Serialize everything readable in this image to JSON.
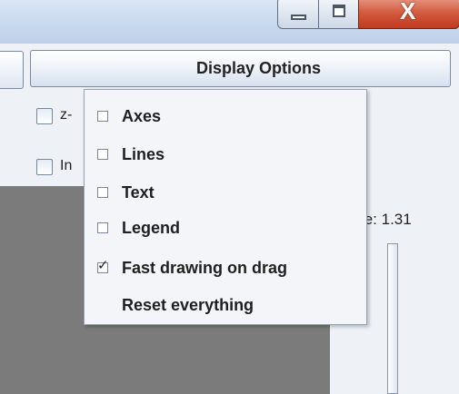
{
  "window_controls": {
    "minimize_icon": "minimize-icon",
    "maximize_icon": "maximize-icon",
    "close_icon": "close-icon",
    "close_glyph": "X"
  },
  "toolbar": {
    "display_options_label": "Display Options"
  },
  "options": [
    {
      "label": "z-",
      "checked": false
    },
    {
      "label": "In",
      "checked": false
    }
  ],
  "scale": {
    "label": "cale: 1.31"
  },
  "menu": {
    "items": [
      {
        "label": "Axes",
        "checkbox": true,
        "checked": false
      },
      {
        "label": "Lines",
        "checkbox": true,
        "checked": false
      },
      {
        "label": "Text",
        "checkbox": true,
        "checked": false
      },
      {
        "label": "Legend",
        "checkbox": true,
        "checked": false
      },
      {
        "label": "Fast drawing on drag",
        "checkbox": true,
        "checked": true
      },
      {
        "label": "Reset everything",
        "checkbox": false,
        "checked": false
      }
    ]
  },
  "colors": {
    "close_button": "#c13a1e",
    "canvas_gray": "#7b7b7b",
    "panel_bg": "#eef2f7"
  }
}
